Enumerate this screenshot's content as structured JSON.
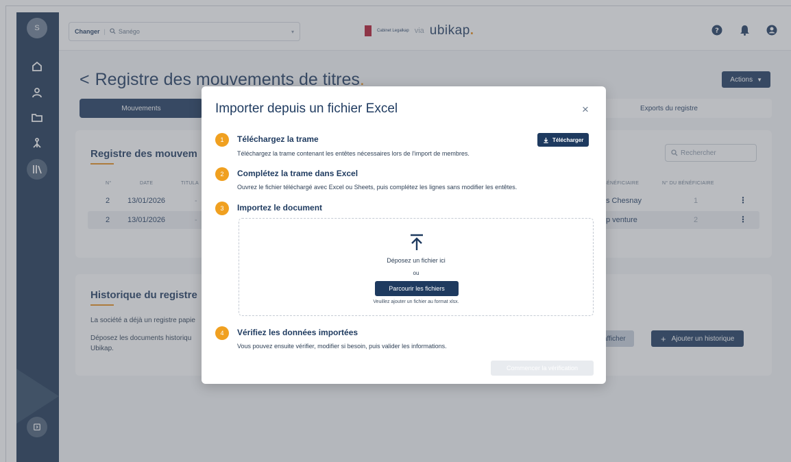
{
  "sidebar": {
    "avatar": "S"
  },
  "topbar": {
    "change_label": "Changer",
    "company_name": "Sanégo",
    "brand_small": "Cabinet Legalkap",
    "brand_via": "via",
    "brand_name": "ubikap",
    "brand_dot": "."
  },
  "page": {
    "title": "Registre des mouvements de titres",
    "title_dot": ".",
    "back": "<",
    "actions_label": "Actions",
    "tabs": {
      "mouvements": "Mouvements",
      "exports": "Exports du registre"
    }
  },
  "registre": {
    "title": "Registre des mouvem",
    "search_placeholder": "Rechercher",
    "headers": {
      "num": "N°",
      "date": "DATE",
      "titulaire": "TITULA",
      "beneficiaire": "BÉNÉFICIAIRE",
      "num_beneficiaire": "N° DU BÉNÉFICIAIRE"
    },
    "rows": [
      {
        "num": "2",
        "date": "13/01/2026",
        "dash": "-",
        "beneficiaire": "s Chesnay",
        "num_beneficiaire": "1"
      },
      {
        "num": "2",
        "date": "13/01/2026",
        "dash": "-",
        "beneficiaire": "p venture",
        "num_beneficiaire": "2"
      }
    ]
  },
  "historique": {
    "title": "Historique du registre",
    "line1": "La société a déjà un registre papie",
    "line2": "Déposez les documents historiqu",
    "line3": "Ubikap.",
    "show_label": "afficher",
    "add_label": "Ajouter un historique"
  },
  "modal": {
    "title": "Importer depuis un fichier Excel",
    "close": "×",
    "steps": [
      {
        "num": "1",
        "title": "Téléchargez la trame",
        "desc": "Téléchargez la trame contenant les entêtes nécessaires lors de l'import de membres."
      },
      {
        "num": "2",
        "title": "Complétez la trame dans Excel",
        "desc": "Ouvrez le fichier téléchargé avec Excel ou Sheets, puis complétez les lignes sans modifier les entêtes."
      },
      {
        "num": "3",
        "title": "Importez le document",
        "desc": ""
      },
      {
        "num": "4",
        "title": "Vérifiez les données importées",
        "desc": "Vous pouvez ensuite vérifier, modifier si besoin, puis valider les informations."
      }
    ],
    "download_label": "Télécharger",
    "dropzone": {
      "drop_text": "Déposez un fichier ici",
      "or_text": "ou",
      "browse_label": "Parcourir les fichiers",
      "hint": "Veuillez ajouter un fichier au format xlsx."
    },
    "start_label": "Commencer la vérification"
  },
  "colors": {
    "navy": "#1e3a5f",
    "orange": "#f0a020",
    "sidebar": "#1c3553"
  }
}
